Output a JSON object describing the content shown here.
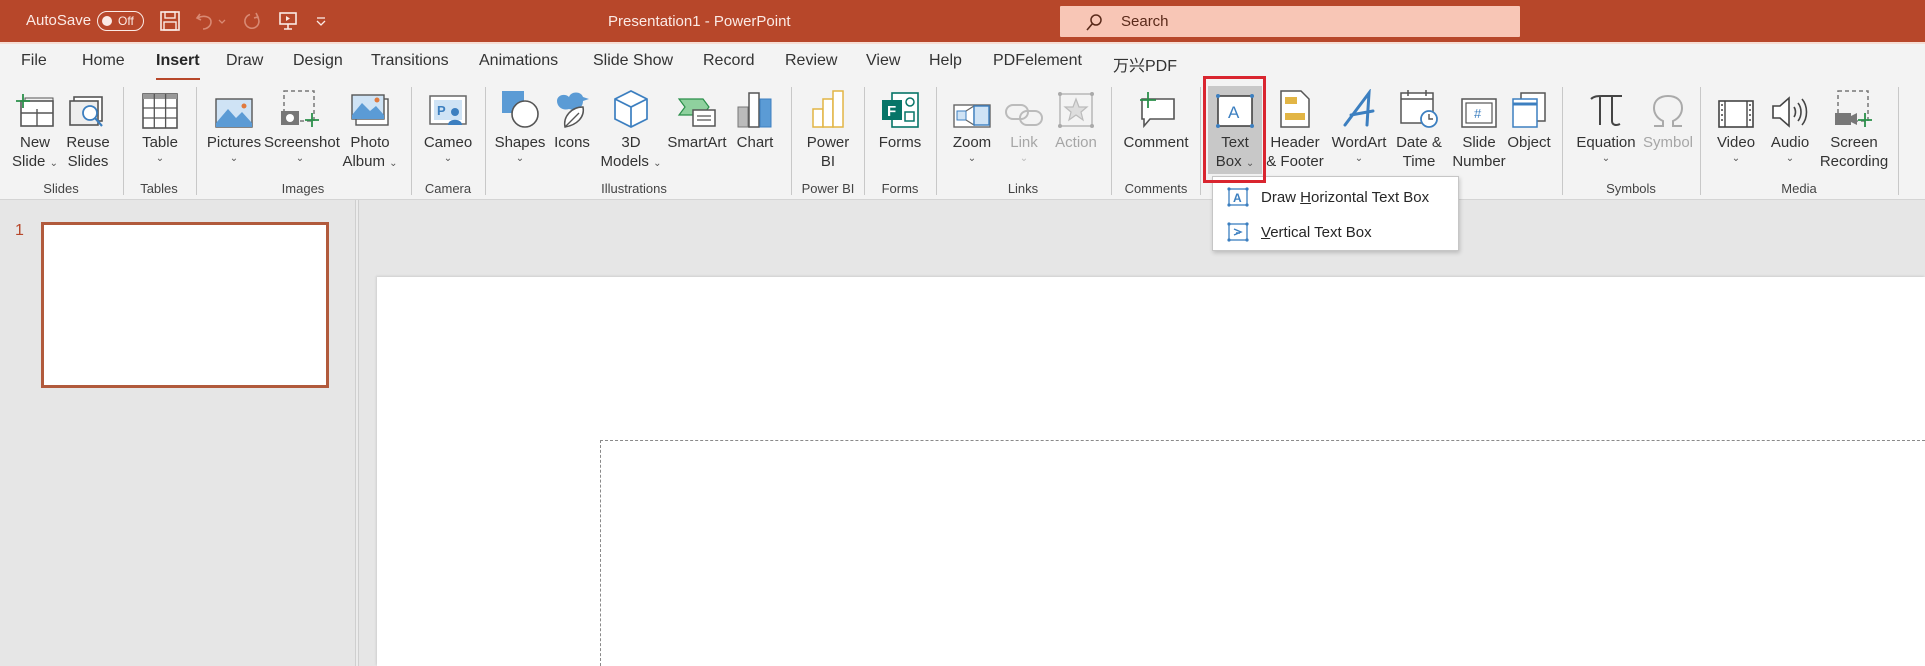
{
  "titlebar": {
    "autosave_label": "AutoSave",
    "autosave_state": "Off",
    "document_title": "Presentation1  -  PowerPoint",
    "search_placeholder": "Search",
    "accent_color": "#b7472a"
  },
  "tabs": [
    {
      "label": "File"
    },
    {
      "label": "Home"
    },
    {
      "label": "Insert",
      "active": true
    },
    {
      "label": "Draw"
    },
    {
      "label": "Design"
    },
    {
      "label": "Transitions"
    },
    {
      "label": "Animations"
    },
    {
      "label": "Slide Show"
    },
    {
      "label": "Record"
    },
    {
      "label": "Review"
    },
    {
      "label": "View"
    },
    {
      "label": "Help"
    },
    {
      "label": "PDFelement"
    },
    {
      "label": "万兴PDF"
    }
  ],
  "ribbon": {
    "groups": {
      "slides": "Slides",
      "tables": "Tables",
      "images": "Images",
      "camera": "Camera",
      "illustrations": "Illustrations",
      "powerbi": "Power BI",
      "forms": "Forms",
      "links": "Links",
      "comments": "Comments",
      "symbols": "Symbols",
      "media": "Media"
    },
    "buttons": {
      "new_slide": [
        "New",
        "Slide"
      ],
      "reuse_slides": [
        "Reuse",
        "Slides"
      ],
      "table": "Table",
      "pictures": "Pictures",
      "screenshot": "Screenshot",
      "photo_album": [
        "Photo",
        "Album"
      ],
      "cameo": "Cameo",
      "shapes": "Shapes",
      "icons": "Icons",
      "models_3d": [
        "3D",
        "Models"
      ],
      "smartart": "SmartArt",
      "chart": "Chart",
      "power_bi": [
        "Power",
        "BI"
      ],
      "forms": "Forms",
      "zoom": "Zoom",
      "link": "Link",
      "action": "Action",
      "comment": "Comment",
      "text_box": [
        "Text",
        "Box"
      ],
      "header_footer": [
        "Header",
        "& Footer"
      ],
      "wordart": "WordArt",
      "date_time": [
        "Date &",
        "Time"
      ],
      "slide_number": [
        "Slide",
        "Number"
      ],
      "object": "Object",
      "equation": "Equation",
      "symbol": "Symbol",
      "video": "Video",
      "audio": "Audio",
      "screen_recording": [
        "Screen",
        "Recording"
      ]
    }
  },
  "textbox_menu": {
    "items": [
      {
        "pre": "Draw ",
        "accel": "H",
        "post": "orizontal Text Box"
      },
      {
        "pre": "",
        "accel": "V",
        "post": "ertical Text Box"
      }
    ]
  },
  "thumbnails": [
    {
      "number": "1"
    }
  ]
}
